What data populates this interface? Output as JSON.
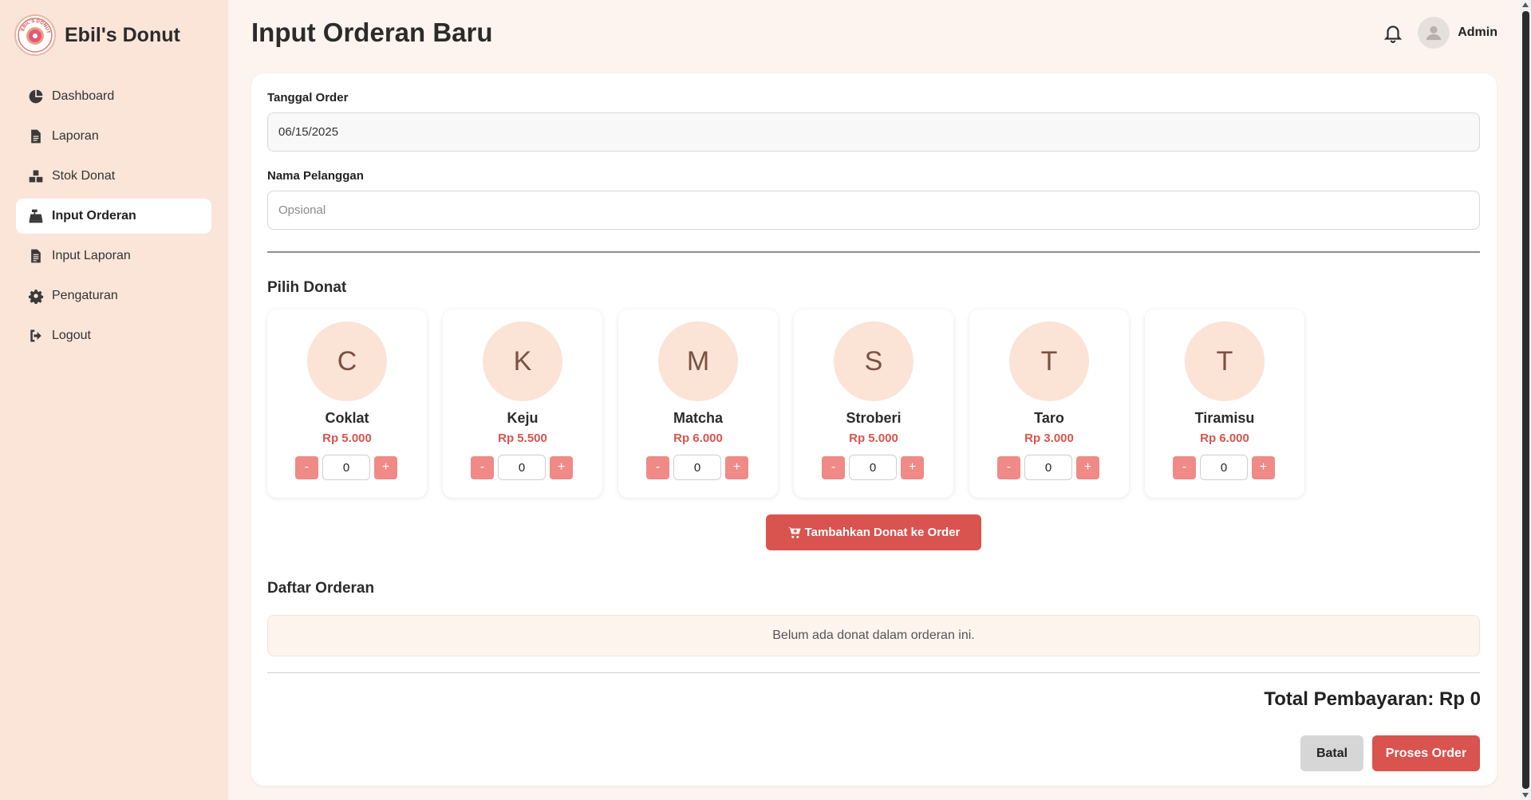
{
  "brand": {
    "name": "Ebil's Donut",
    "logo_icon": "donut-logo-icon",
    "logo_text": "EBIL'S DONUT"
  },
  "sidebar": {
    "items": [
      {
        "label": "Dashboard",
        "icon": "pie-chart-icon",
        "active": false
      },
      {
        "label": "Laporan",
        "icon": "document-icon",
        "active": false
      },
      {
        "label": "Stok Donat",
        "icon": "boxes-icon",
        "active": false
      },
      {
        "label": "Input Orderan",
        "icon": "cash-register-icon",
        "active": true
      },
      {
        "label": "Input Laporan",
        "icon": "file-lines-icon",
        "active": false
      },
      {
        "label": "Pengaturan",
        "icon": "gear-icon",
        "active": false
      },
      {
        "label": "Logout",
        "icon": "logout-icon",
        "active": false
      }
    ]
  },
  "header": {
    "title": "Input Orderan Baru",
    "user": "Admin",
    "bell_icon": "bell-icon",
    "avatar_icon": "user-avatar-icon"
  },
  "form": {
    "date_label": "Tanggal Order",
    "date_value": "06/15/2025",
    "customer_label": "Nama Pelanggan",
    "customer_placeholder": "Opsional",
    "customer_value": ""
  },
  "donuts": {
    "section_title": "Pilih Donat",
    "items": [
      {
        "initial": "C",
        "name": "Coklat",
        "price": "Rp 5.000",
        "qty": "0"
      },
      {
        "initial": "K",
        "name": "Keju",
        "price": "Rp 5.500",
        "qty": "0"
      },
      {
        "initial": "M",
        "name": "Matcha",
        "price": "Rp 6.000",
        "qty": "0"
      },
      {
        "initial": "S",
        "name": "Stroberi",
        "price": "Rp 5.000",
        "qty": "0"
      },
      {
        "initial": "T",
        "name": "Taro",
        "price": "Rp 3.000",
        "qty": "0"
      },
      {
        "initial": "T",
        "name": "Tiramisu",
        "price": "Rp 6.000",
        "qty": "0"
      }
    ],
    "minus_label": "-",
    "plus_label": "+",
    "add_button": "Tambahkan Donat ke Order",
    "add_icon": "cart-plus-icon"
  },
  "order": {
    "section_title": "Daftar Orderan",
    "empty_text": "Belum ada donat dalam orderan ini.",
    "total": "Total Pembayaran: Rp 0",
    "cancel_label": "Batal",
    "process_label": "Proses Order"
  },
  "colors": {
    "accent": "#d9534f",
    "accent_light": "#ef8a86",
    "sidebar_bg": "#fbe5d9",
    "page_bg": "#fdf4ef",
    "donut_avatar_bg": "#fbe3d6"
  }
}
